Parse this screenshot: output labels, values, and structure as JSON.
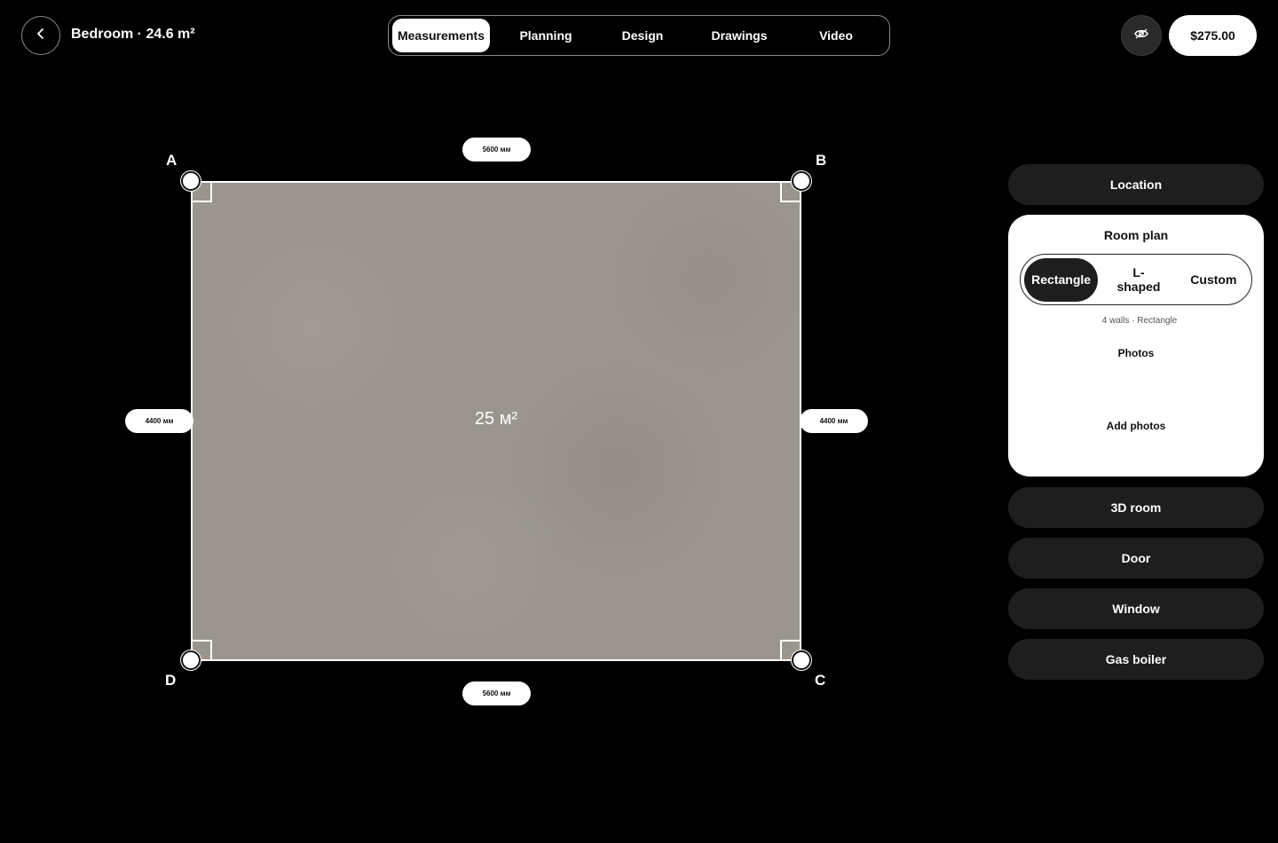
{
  "header": {
    "title": "Bedroom · 24.6 m²",
    "tabs": [
      {
        "label": "Measurements",
        "active": true
      },
      {
        "label": "Planning",
        "active": false
      },
      {
        "label": "Design",
        "active": false
      },
      {
        "label": "Drawings",
        "active": false
      },
      {
        "label": "Video",
        "active": false
      }
    ],
    "price": "$275.00",
    "icons": {
      "back": "chevron-left-icon",
      "view": "eye-icon"
    }
  },
  "plan": {
    "area": "25 м²",
    "corners": {
      "a": "A",
      "b": "B",
      "c": "C",
      "d": "D"
    },
    "dimensions": {
      "top": "5600 мм",
      "bottom": "5600 мм",
      "left": "4400 мм",
      "right": "4400 мм"
    },
    "floor_color": "#9a958e"
  },
  "panel": {
    "location": "Location",
    "room_plan": {
      "title": "Room plan",
      "options": [
        "Rectangle",
        "L-shaped",
        "Custom"
      ],
      "selected": "Rectangle",
      "subtitle": "4 walls · Rectangle",
      "photos_label": "Photos",
      "add_photos": "Add photos"
    },
    "buttons": [
      "3D room",
      "Door",
      "Window",
      "Gas boiler"
    ]
  }
}
